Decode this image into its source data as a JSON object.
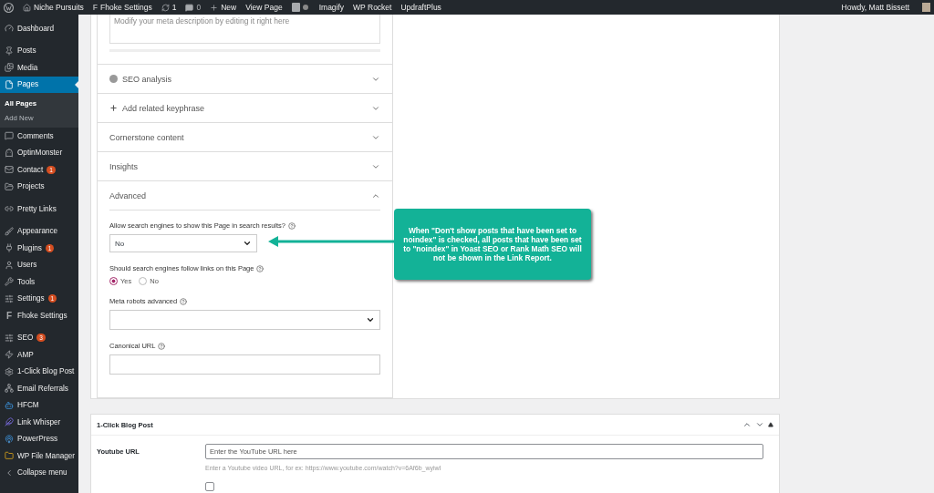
{
  "admin_bar": {
    "items": [
      {
        "kind": "wp-logo"
      },
      {
        "kind": "home",
        "label": "Niche Pursuits"
      },
      {
        "kind": "glyph",
        "glyph": "F",
        "label": "Fhoke Settings"
      },
      {
        "kind": "updates",
        "label": "1"
      },
      {
        "kind": "comments",
        "label": "0"
      },
      {
        "kind": "new",
        "label": "New"
      },
      {
        "kind": "text",
        "label": "View Page"
      },
      {
        "kind": "yoast"
      },
      {
        "kind": "text",
        "label": "Imagify"
      },
      {
        "kind": "text",
        "label": "WP Rocket"
      },
      {
        "kind": "text",
        "label": "UpdraftPlus"
      }
    ],
    "greeting": "Howdy, Matt Bissett"
  },
  "sidebar": {
    "groups": [
      [
        {
          "kind": "dashboard",
          "label": "Dashboard",
          "selected": false
        }
      ],
      [
        {
          "kind": "pin",
          "label": "Posts",
          "selected": false
        },
        {
          "kind": "media",
          "label": "Media",
          "selected": false
        },
        {
          "kind": "page",
          "label": "Pages",
          "selected": true,
          "children": [
            {
              "label": "All Pages",
              "selected": true
            },
            {
              "label": "Add New",
              "selected": false
            }
          ]
        },
        {
          "kind": "comment",
          "label": "Comments",
          "selected": false
        },
        {
          "kind": "monster",
          "label": "OptinMonster",
          "selected": false
        },
        {
          "kind": "mail",
          "label": "Contact",
          "badge": "1",
          "selected": false
        },
        {
          "kind": "folder",
          "label": "Projects",
          "selected": false
        }
      ],
      [
        {
          "kind": "link",
          "label": "Pretty Links",
          "selected": false
        }
      ],
      [
        {
          "kind": "brush",
          "label": "Appearance",
          "selected": false
        },
        {
          "kind": "plug",
          "label": "Plugins",
          "badge": "1",
          "selected": false
        },
        {
          "kind": "user",
          "label": "Users",
          "selected": false
        },
        {
          "kind": "wrench",
          "label": "Tools",
          "selected": false
        },
        {
          "kind": "settings",
          "label": "Settings",
          "badge": "1",
          "selected": false
        },
        {
          "kind": "glyph",
          "glyph": "F",
          "label": "Fhoke Settings",
          "selected": false
        }
      ],
      [
        {
          "kind": "yoast",
          "label": "SEO",
          "badge": "3",
          "selected": false
        },
        {
          "kind": "bolt",
          "label": "AMP",
          "selected": false
        },
        {
          "kind": "gear",
          "label": "1-Click Blog Post",
          "selected": false
        },
        {
          "kind": "network",
          "label": "Email Referrals",
          "selected": false
        },
        {
          "kind": "bot",
          "label": "HFCM",
          "selected": false
        },
        {
          "kind": "feather",
          "label": "Link Whisper",
          "selected": false
        },
        {
          "kind": "podcast",
          "label": "PowerPress",
          "selected": false
        },
        {
          "kind": "filefolder",
          "label": "WP File Manager",
          "selected": false
        },
        {
          "kind": "collapse",
          "label": "Collapse menu",
          "selected": false
        }
      ]
    ]
  },
  "yoast": {
    "meta_description": {
      "placeholder": "Modify your meta description by editing it right here"
    },
    "sections": [
      {
        "label": "SEO analysis",
        "kind": "dot",
        "expanded": false
      },
      {
        "label": "Add related keyphrase",
        "kind": "plus",
        "expanded": false
      },
      {
        "label": "Cornerstone content",
        "kind": "plain",
        "expanded": false
      },
      {
        "label": "Insights",
        "kind": "plain",
        "expanded": false
      },
      {
        "label": "Advanced",
        "kind": "plain",
        "expanded": true
      }
    ],
    "advanced": [
      {
        "kind": "select",
        "label": "Allow search engines to show this Page in search results?",
        "value": "No"
      },
      {
        "kind": "radio",
        "label": "Should search engines follow links on this Page",
        "options": [
          {
            "label": "Yes",
            "selected": true
          },
          {
            "label": "No",
            "selected": false
          }
        ]
      },
      {
        "kind": "select-wide",
        "label": "Meta robots advanced"
      },
      {
        "kind": "text",
        "label": "Canonical URL"
      }
    ]
  },
  "callout": {
    "text": "When \"Don't show posts that have been set to noindex\" is checked, all posts that have been set to \"noindex\" in Yoast SEO or Rank Math SEO will not be shown in the Link Report."
  },
  "blog_post_box": {
    "title": "1-Click Blog Post",
    "youtube": {
      "label": "Youtube URL",
      "placeholder": "Enter the YouTube URL here",
      "help": "Enter a Youtube video URL, for ex: https://www.youtube.com/watch?v=6Af6b_wyiwI"
    },
    "insert_video": {
      "checked": false
    }
  }
}
